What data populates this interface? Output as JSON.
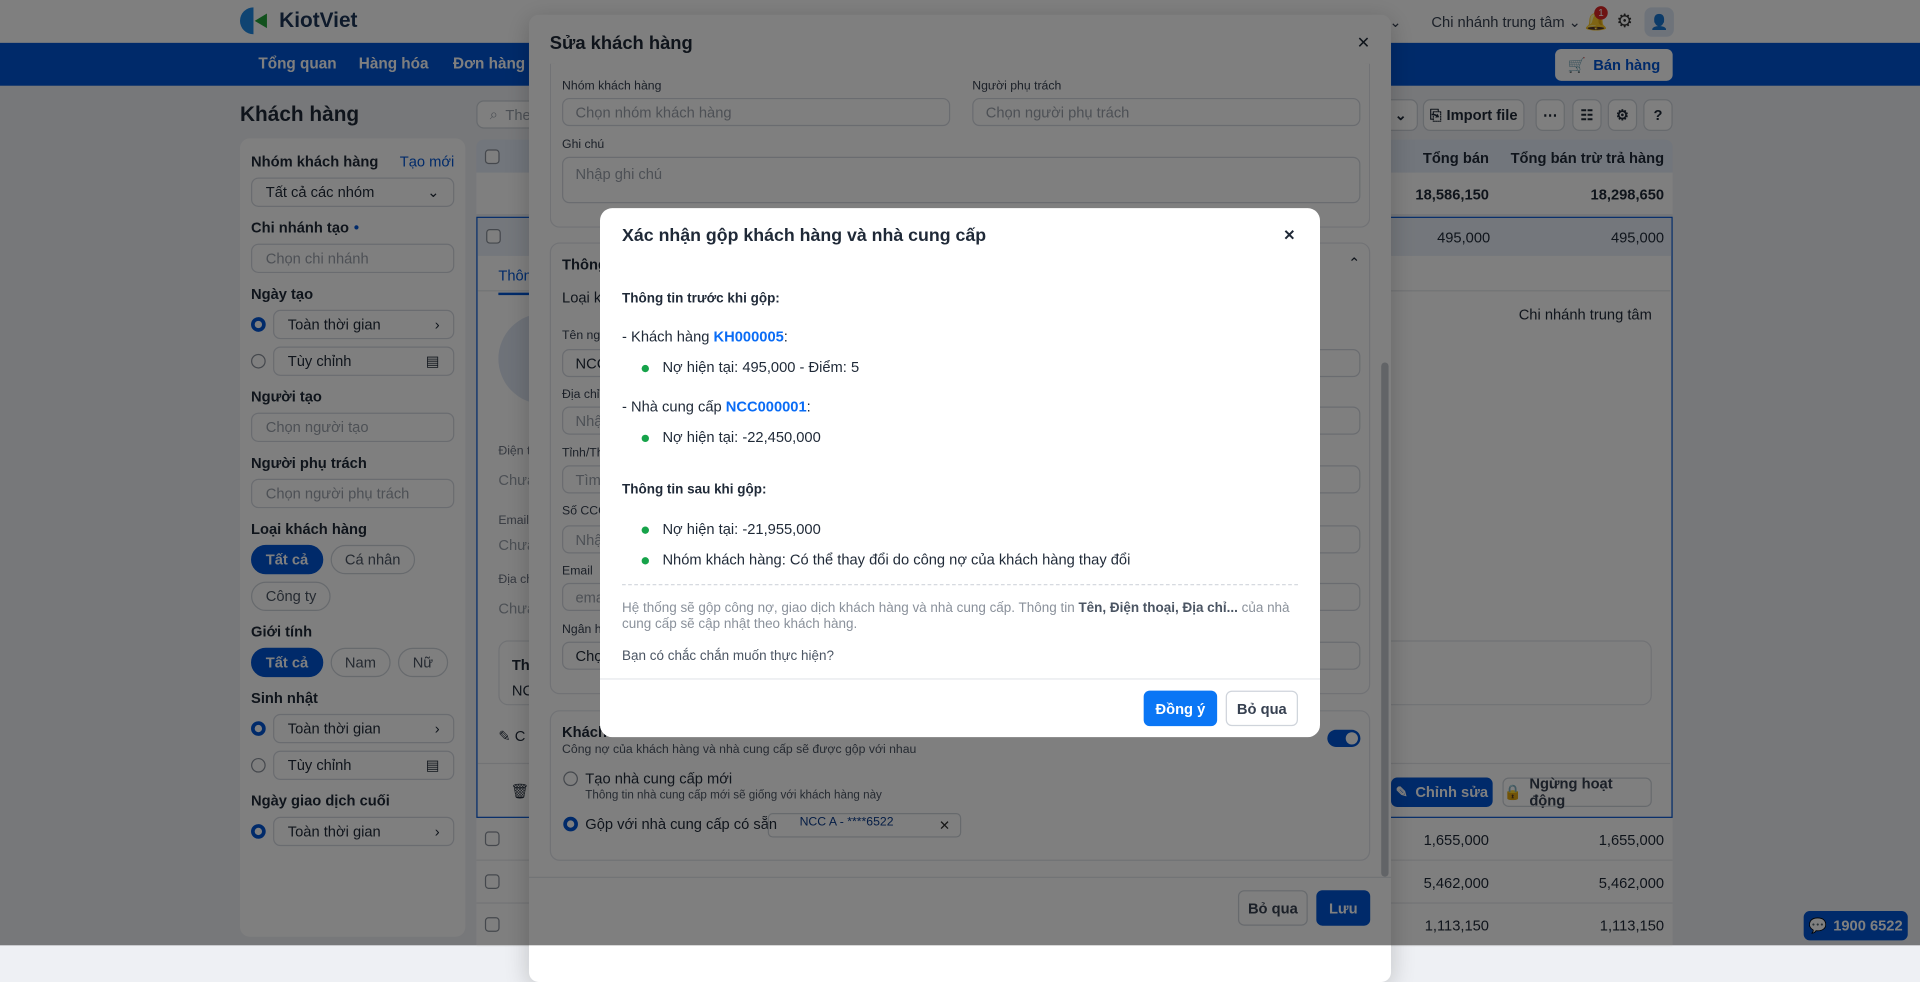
{
  "app": {
    "brand": "KiotViet",
    "branch": "Chi nhánh trung tâm",
    "notification_count": "1",
    "hidden_menu_fragment": "t"
  },
  "nav": {
    "items": [
      "Tổng quan",
      "Hàng hóa",
      "Đơn hàng"
    ],
    "sell_button": "Bán hàng"
  },
  "page": {
    "title": "Khách hàng",
    "search_placeholder": "The",
    "import_label": "Import file"
  },
  "filters": {
    "group_label": "Nhóm khách hàng",
    "create_link": "Tạo mới",
    "group_value": "Tất cả các nhóm",
    "branch_label": "Chi nhánh tạo",
    "branch_placeholder": "Chọn chi nhánh",
    "created_label": "Ngày tạo",
    "all_time": "Toàn thời gian",
    "custom": "Tùy chỉnh",
    "creator_label": "Người tạo",
    "creator_placeholder": "Chọn người tạo",
    "owner_label": "Người phụ trách",
    "owner_placeholder": "Chọn người phụ trách",
    "type_label": "Loại khách hàng",
    "type_options": [
      "Tất cả",
      "Cá nhân",
      "Công ty"
    ],
    "gender_label": "Giới tính",
    "gender_options": [
      "Tất cả",
      "Nam",
      "Nữ"
    ],
    "birthday_label": "Sinh nhật",
    "last_tx_label": "Ngày giao dịch cuối"
  },
  "table": {
    "headers": [
      "Tổng bán",
      "Tổng bán trừ trả hàng"
    ],
    "summary": [
      "18,586,150",
      "18,298,650"
    ],
    "selected": [
      "495,000",
      "495,000"
    ],
    "detail": {
      "tab": "Thôn",
      "branch": "Chi nhánh trung tâm",
      "phone_label": "Điện t",
      "email_label": "Email",
      "address_label": "Địa ch",
      "empty": "Chưa",
      "box_title": "Th",
      "box_value": "NC",
      "note_prefix": "C",
      "edit_button": "Chỉnh sửa",
      "deactivate_button": "Ngừng hoạt động"
    },
    "rows": [
      [
        "1,655,000",
        "1,655,000"
      ],
      [
        "5,462,000",
        "5,462,000"
      ],
      [
        "1,113,150",
        "1,113,150"
      ]
    ]
  },
  "edit_modal": {
    "title": "Sửa khách hàng",
    "group_label": "Nhóm khách hàng",
    "group_placeholder": "Chọn nhóm khách hàng",
    "owner_label": "Người phụ trách",
    "owner_placeholder": "Chọn người phụ trách",
    "note_label": "Ghi chú",
    "note_placeholder": "Nhập ghi chú",
    "section_title": "Thông",
    "type_label": "Loại kh",
    "fields": [
      {
        "label": "Tên ngư",
        "value": "NCC"
      },
      {
        "label": "Địa chỉ",
        "value": "Nhập"
      },
      {
        "label": "Tỉnh/Th",
        "value": "Tìm"
      },
      {
        "label": "Số CCC",
        "value": "Nhập"
      },
      {
        "label": "Email",
        "value": "emai"
      },
      {
        "label": "Ngân h",
        "value": "Chọn"
      }
    ],
    "supplier_title": "Khách",
    "supplier_desc": "Công nợ của khách hàng và nhà cung cấp sẽ được gộp với nhau",
    "option_new": "Tạo nhà cung cấp mới",
    "option_new_desc": "Thông tin nhà cung cấp mới sẽ giống với khách hàng này",
    "option_merge": "Gộp với nhà cung cấp có sẵn",
    "merge_value": "NCC A - ****6522",
    "cancel": "Bỏ qua",
    "save": "Lưu"
  },
  "dialog": {
    "title": "Xác nhận gộp khách hàng và nhà cung cấp",
    "before_heading": "Thông tin trước khi gộp:",
    "customer_prefix": "- Khách hàng ",
    "customer_code": "KH000005",
    "customer_debt": "Nợ hiện tại: 495,000 - Điểm: 5",
    "supplier_prefix": "- Nhà cung cấp ",
    "supplier_code": "NCC000001",
    "supplier_debt": "Nợ hiện tại: -22,450,000",
    "after_heading": "Thông tin sau khi gộp:",
    "after_debt": "Nợ hiện tại: -21,955,000",
    "after_group": "Nhóm khách hàng: Có thể thay đổi do công nợ của khách hàng thay đổi",
    "note_1": "Hệ thống sẽ gộp công nợ, giao dịch khách hàng và nhà cung cấp. Thông tin ",
    "note_bold": "Tên, Điện thoại, Địa chỉ...",
    "note_2": " của nhà cung cấp sẽ cập nhật theo khách hàng.",
    "question": "Bạn có chắc chắn muốn thực hiện?",
    "confirm": "Đồng ý",
    "cancel": "Bỏ qua"
  },
  "hotline": "1900 6522",
  "colors": {
    "brand": "#0055d4",
    "link": "#0a6cf5",
    "bullet": "#16a34a"
  }
}
